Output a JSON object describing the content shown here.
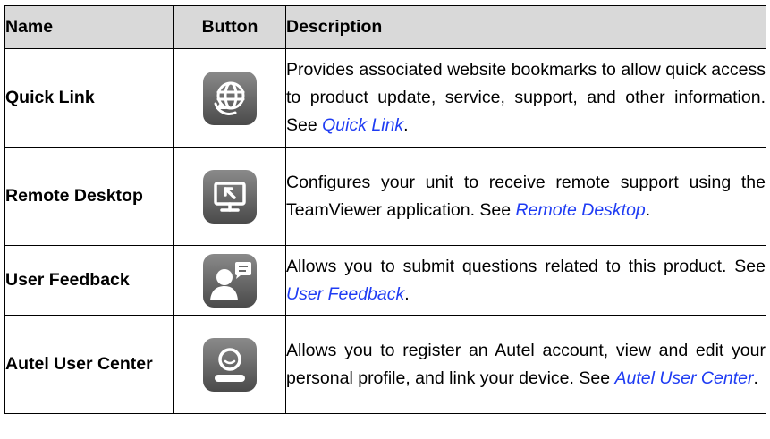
{
  "headers": {
    "name": "Name",
    "button": "Button",
    "description": "Description"
  },
  "rows": [
    {
      "name": "Quick Link",
      "icon": "globe-refresh-icon",
      "desc_text": "Provides associated website bookmarks to allow quick access to product update, service, support, and other information. See ",
      "link": "Quick Link",
      "after": "."
    },
    {
      "name": "Remote Desktop",
      "icon": "remote-desktop-monitor-icon",
      "desc_text": "Configures your unit to receive remote support using the TeamViewer application. See ",
      "link": "Remote Desktop",
      "after": "."
    },
    {
      "name": "User Feedback",
      "icon": "user-feedback-icon",
      "desc_text": "Allows you to submit questions related to this product. See ",
      "link": "User Feedback",
      "after": "."
    },
    {
      "name": "Autel User Center",
      "icon": "user-center-icon",
      "desc_text": "Allows you to register an Autel account, view and edit your personal profile, and link your device. See ",
      "link": "Autel User Center",
      "after": "."
    }
  ],
  "colors": {
    "link": "#1f3cf3",
    "header_bg": "#d9d9d9",
    "icon_top": "#8a8a8a",
    "icon_bottom": "#4a4a4a"
  }
}
